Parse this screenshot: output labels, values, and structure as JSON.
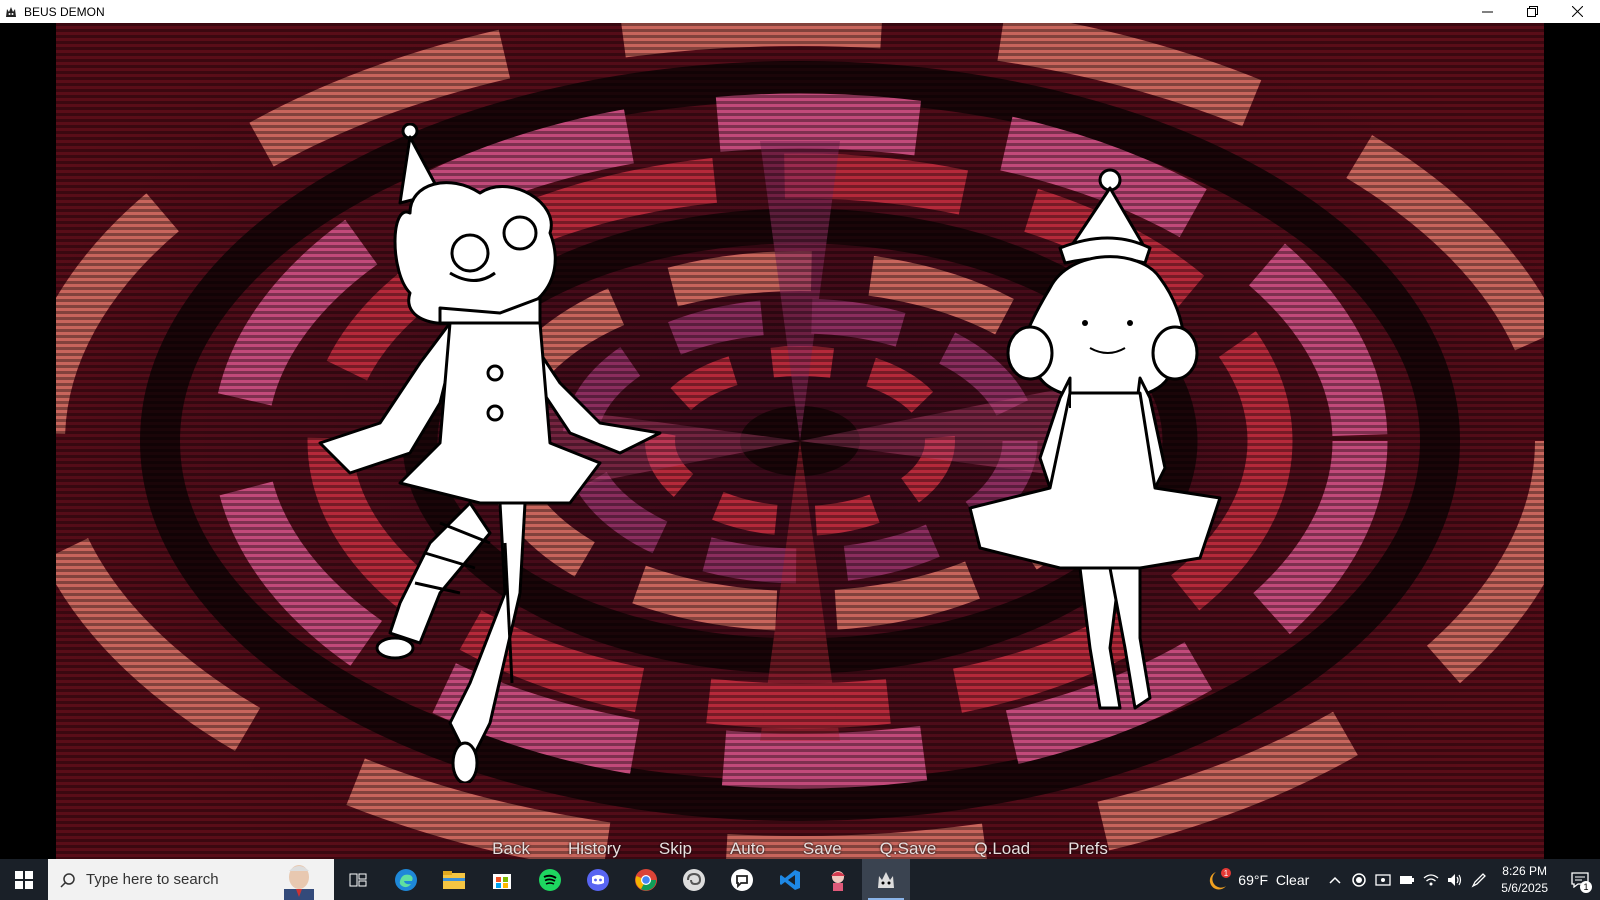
{
  "window": {
    "title": "BEUS DEMON",
    "icon": "demon-app-icon",
    "controls": [
      "minimize-icon",
      "restore-icon",
      "close-icon"
    ]
  },
  "game": {
    "background": "red-purple-concentric-spiral",
    "characters": [
      {
        "name": "clown-girl-curly-hair",
        "position": "left"
      },
      {
        "name": "clown-girl-tutu",
        "position": "right"
      }
    ],
    "quick_menu": {
      "back": "Back",
      "history": "History",
      "skip": "Skip",
      "auto": "Auto",
      "save": "Save",
      "qsave": "Q.Save",
      "qload": "Q.Load",
      "prefs": "Prefs"
    }
  },
  "taskbar": {
    "search_placeholder": "Type here to search",
    "pinned": [
      "task-view-icon",
      "edge-icon",
      "file-explorer-icon",
      "store-icon",
      "spotify-icon",
      "discord-icon",
      "chrome-icon",
      "app-swirl-icon",
      "app-chat-icon",
      "vscode-icon",
      "game-character-icon",
      "beus-demon-icon"
    ],
    "weather": {
      "temp": "69°F",
      "condition": "Clear",
      "alert": "1"
    },
    "clock": {
      "time": "8:26 PM",
      "date": "5/6/2025"
    },
    "notifications": "1"
  },
  "colors": {
    "taskbar_bg": "#1a2028",
    "spiral_dark": "#1a0508",
    "spiral_red": "#b5293a",
    "spiral_pink": "#c24a7a",
    "spiral_salmon": "#c8655c"
  }
}
